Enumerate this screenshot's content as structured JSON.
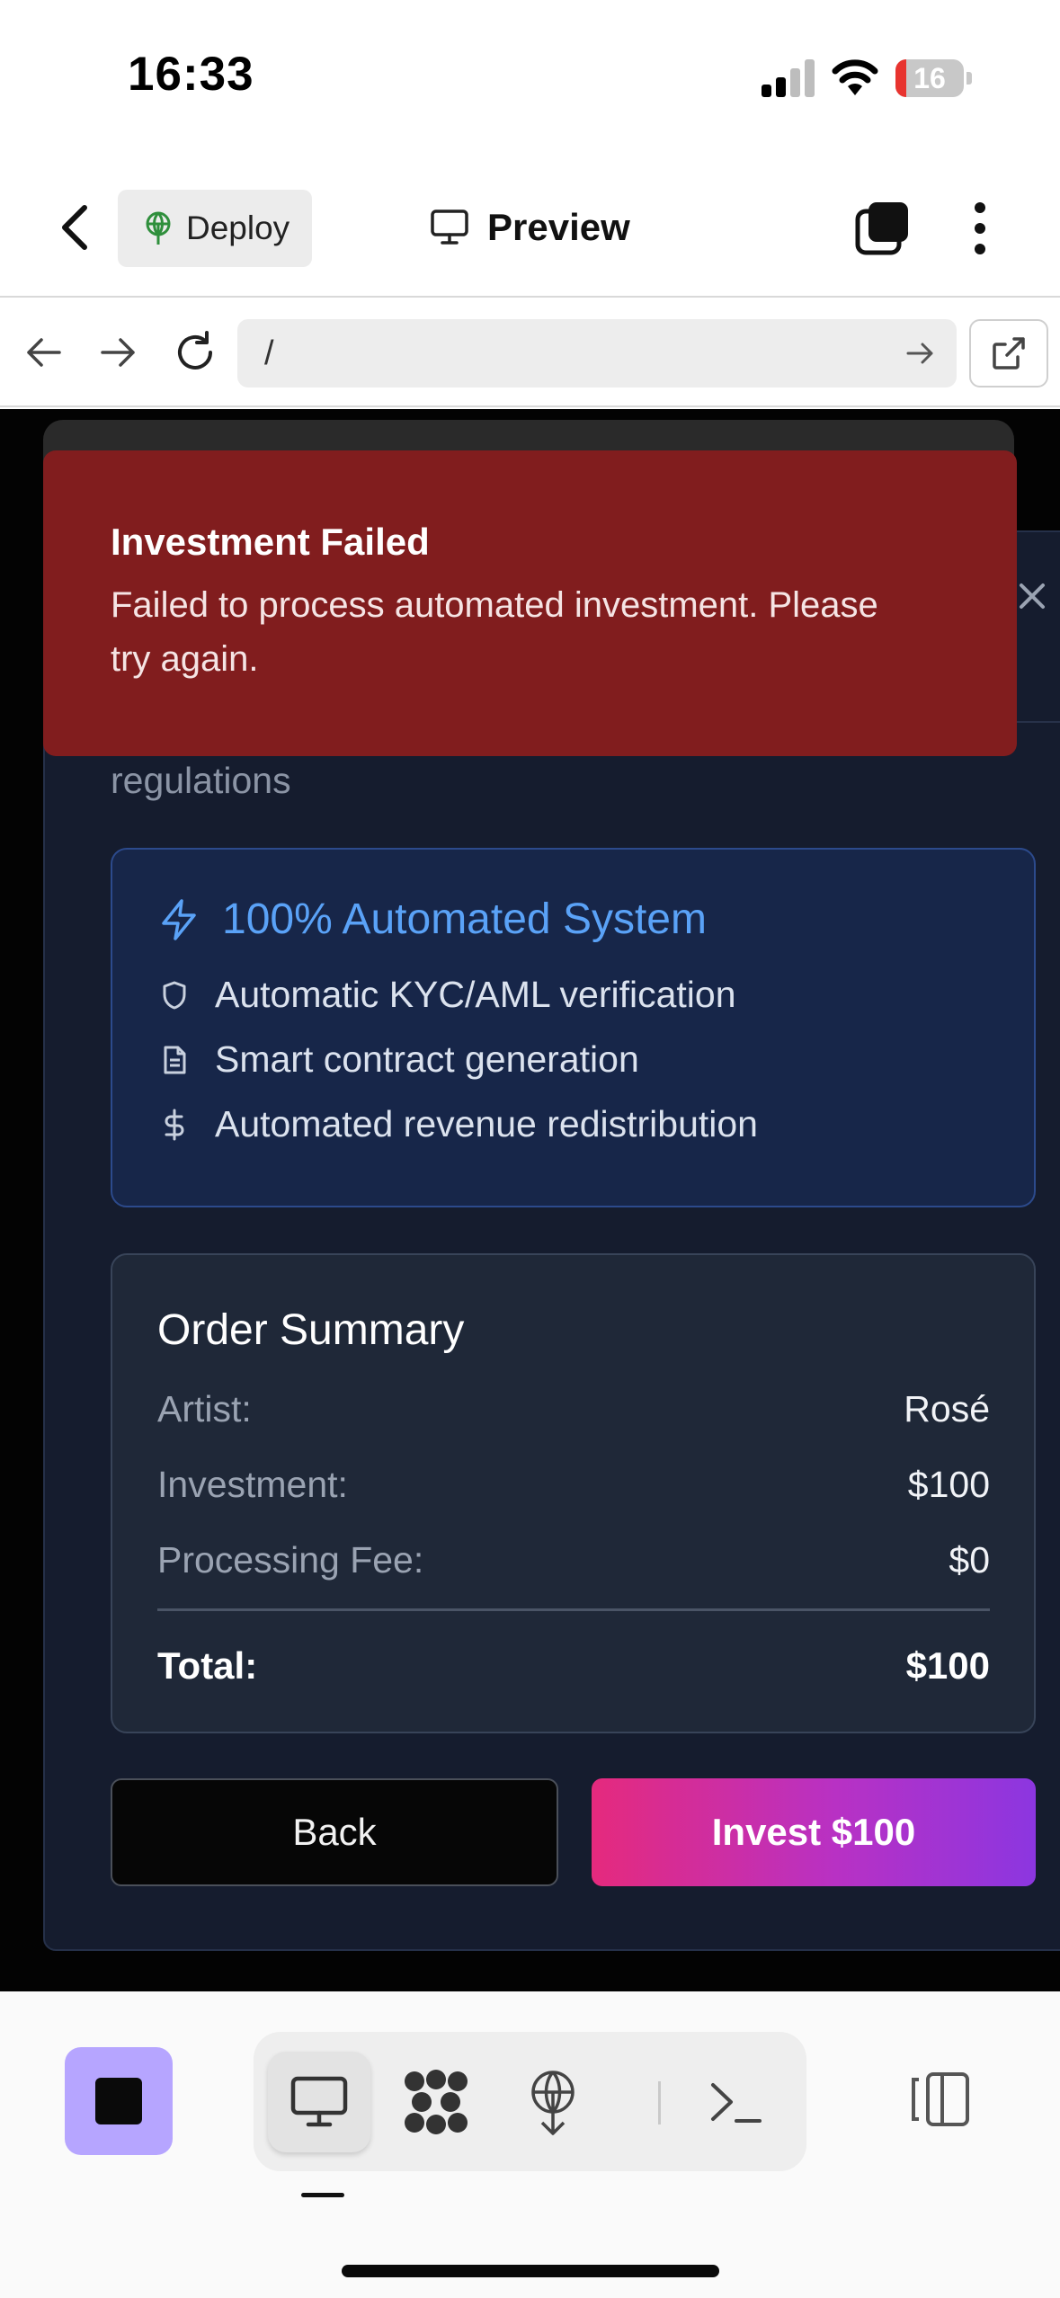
{
  "status_bar": {
    "time": "16:33",
    "battery": "16",
    "battery_level": 0.16
  },
  "header": {
    "deploy_label": "Deploy",
    "preview_label": "Preview"
  },
  "browser": {
    "url": "/"
  },
  "toast": {
    "title": "Investment Failed",
    "message": "Failed to process automated investment. Please try again."
  },
  "dialog": {
    "partial_text": "regulations",
    "automated": {
      "title": "100% Automated System",
      "features": [
        {
          "icon": "shield-icon",
          "text": "Automatic KYC/AML verification"
        },
        {
          "icon": "document-icon",
          "text": "Smart contract generation"
        },
        {
          "icon": "dollar-icon",
          "text": "Automated revenue redistribution"
        }
      ]
    },
    "order_summary": {
      "title": "Order Summary",
      "rows": [
        {
          "label": "Artist:",
          "value": "Rosé"
        },
        {
          "label": "Investment:",
          "value": "$100"
        },
        {
          "label": "Processing Fee:",
          "value": "$0"
        }
      ],
      "total_label": "Total:",
      "total_value": "$100"
    },
    "back_label": "Back",
    "invest_label": "Invest $100"
  },
  "colors": {
    "toast_bg": "#811d1e",
    "dialog_bg": "#151c2e",
    "accent_blue": "#5aa2f7",
    "invest_gradient_start": "#e52a7d",
    "invest_gradient_end": "#8c36e0",
    "stop_button": "#b6a5ff"
  },
  "toolbar": {
    "items": [
      "monitor-icon",
      "cluster-icon",
      "deploy-icon",
      "terminal-icon"
    ],
    "active": "monitor-icon"
  }
}
